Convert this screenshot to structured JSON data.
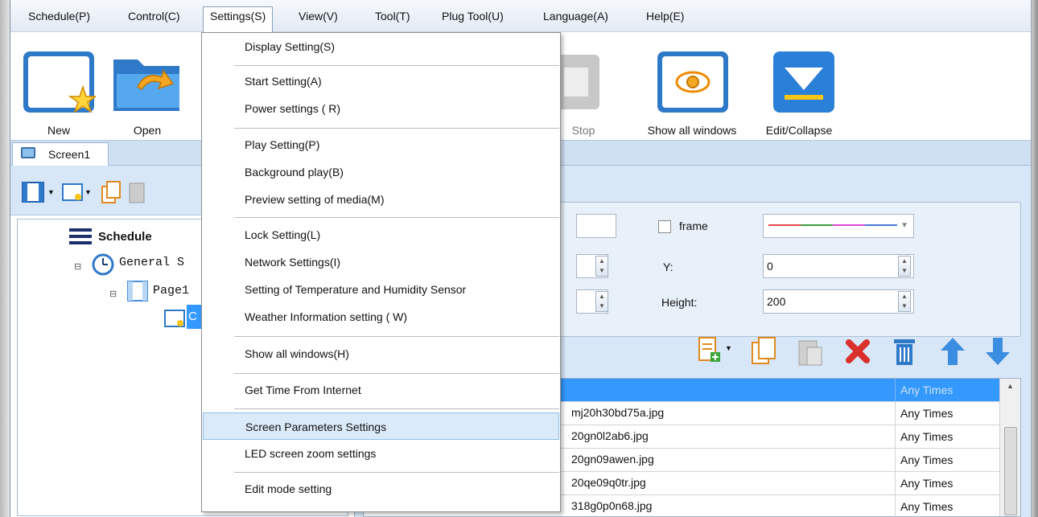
{
  "menubar": {
    "items": [
      "Schedule(P)",
      "Control(C)",
      "Settings(S)",
      "View(V)",
      "Tool(T)",
      "Plug Tool(U)",
      "Language(A)",
      "Help(E)"
    ]
  },
  "toolbar": {
    "new": "New",
    "open": "Open",
    "stop": "Stop",
    "show_all": "Show all windows",
    "edit_collapse": "Edit/Collapse"
  },
  "tab": {
    "label": "Screen1"
  },
  "tree": {
    "schedule": "Schedule",
    "general": "General S",
    "page": "Page1",
    "item": "C"
  },
  "properties": {
    "frame_label": "frame",
    "y_label": "Y:",
    "y_value": "0",
    "height_label": "Height:",
    "height_value": "200"
  },
  "playlist": {
    "header_times": "Any Times",
    "rows": [
      {
        "name": "mj20h30bd75a.jpg",
        "times": "Any Times"
      },
      {
        "name": "20gn0l2ab6.jpg",
        "times": "Any Times"
      },
      {
        "name": "20gn09awen.jpg",
        "times": "Any Times"
      },
      {
        "name": "20qe09q0tr.jpg",
        "times": "Any Times"
      },
      {
        "name": "318g0p0n68.jpg",
        "times": "Any Times"
      }
    ]
  },
  "settings_menu": {
    "items": [
      "Display Setting(S)",
      "Start Setting(A)",
      "Power settings ( R)",
      "Play Setting(P)",
      "Background play(B)",
      "Preview setting of media(M)",
      "Lock Setting(L)",
      "Network Settings(I)",
      "Setting of Temperature and Humidity Sensor",
      "Weather Information setting ( W)",
      "Show all windows(H)",
      "Get Time From Internet",
      "Screen Parameters Settings",
      "LED screen zoom settings",
      "Edit mode setting"
    ],
    "highlighted": "Screen Parameters Settings"
  }
}
